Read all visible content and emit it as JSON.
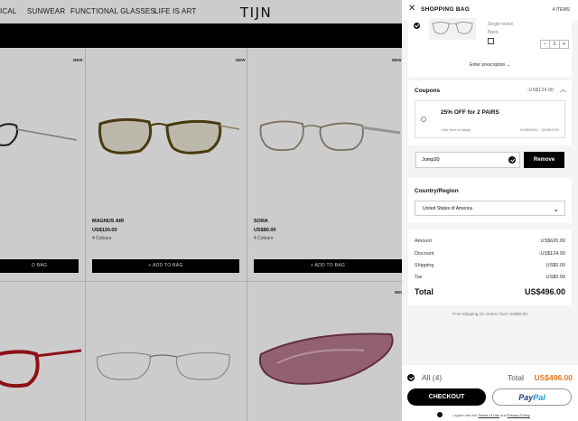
{
  "nav": {
    "links": [
      "ICAL",
      "SUNWEAR",
      "FUNCTIONAL GLASSES",
      "LIFE IS ART"
    ],
    "logo": "TIJN"
  },
  "products": [
    {
      "tag": "NEW",
      "name": "",
      "price": "",
      "colours": "",
      "button": "O BAG"
    },
    {
      "tag": "NEW",
      "name": "MAGNUS AIR",
      "price": "US$120.00",
      "colours": "4 Colours",
      "button": "+ ADD TO BAG"
    },
    {
      "tag": "NEW",
      "name": "SORA",
      "price": "US$80.00",
      "colours": "4 Colours",
      "button": "+ ADD TO BAG"
    },
    {
      "tag": "NEW"
    }
  ],
  "bag": {
    "title": "SHOPPING BAG",
    "count": "4 ITEMS",
    "item": {
      "lens": "Single-vision",
      "type": "Basic",
      "qty": "1",
      "minus": "−",
      "plus": "+"
    },
    "enter_prescription": "Enter prescription",
    "coupons": {
      "title": "Coupons",
      "value": "-US$124.00",
      "offer": "25% OFF for 2 PAIRS",
      "click_hint": "Click here to apply",
      "dates": "11/08/2020 - 12/08/2020"
    },
    "code": {
      "value": "Jump20",
      "remove": "Remove"
    },
    "region": {
      "title": "Country/Region",
      "selected": "United States of America"
    },
    "summary": {
      "rows": [
        {
          "label": "Amount",
          "value": "US$620.00"
        },
        {
          "label": "Discount",
          "value": "-US$124.00"
        },
        {
          "label": "Shipping",
          "value": "US$0.00"
        },
        {
          "label": "Tax",
          "value": "US$0.00"
        }
      ],
      "total_label": "Total",
      "total_value": "US$496.00"
    },
    "free_shipping": "Free Shipping On Orders Over US$89.00",
    "footer": {
      "all_label": "All (4)",
      "total_label": "Total",
      "total_value": "US$496.00",
      "checkout": "CHECKOUT",
      "paypal_a": "Pay",
      "paypal_b": "Pal",
      "agree_prefix": "I agree with the",
      "terms": "Terms of Use",
      "and": "and",
      "privacy": "Privacy Policy"
    }
  },
  "colors": {
    "accent": "#e07a1e",
    "primary": "#000000",
    "panel_bg": "#f4f4f4"
  }
}
